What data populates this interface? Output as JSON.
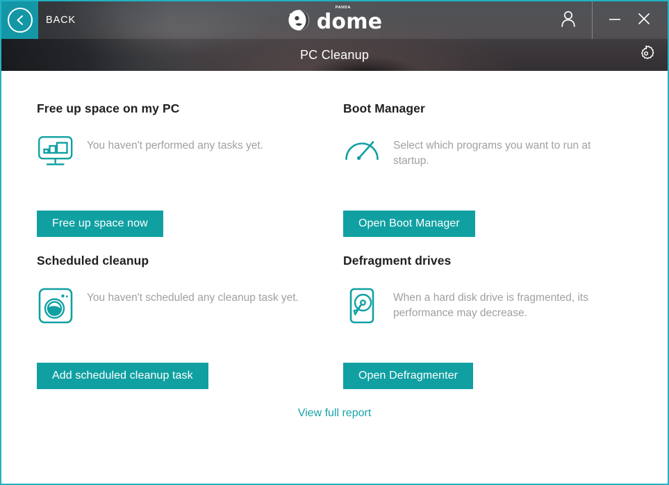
{
  "window": {
    "accent_color": "#11a0a2",
    "border_color": "#21b3c4",
    "back_label": "BACK",
    "brand_name": "dome",
    "brand_super": "PANDA",
    "page_title": "PC Cleanup",
    "icons": {
      "back": "chevron-left-icon",
      "account": "user-icon",
      "minimize": "minimize-icon",
      "close": "close-icon",
      "settings": "gear-icon"
    }
  },
  "cards": [
    {
      "title": "Free up space on my PC",
      "description": "You haven't performed any tasks yet.",
      "icon": "monitor-chart-icon",
      "button": "Free up space now"
    },
    {
      "title": "Boot Manager",
      "description": "Select which programs you want to run at startup.",
      "icon": "speedometer-icon",
      "button": "Open Boot Manager"
    },
    {
      "title": "Scheduled cleanup",
      "description": "You haven't scheduled any cleanup task yet.",
      "icon": "washing-machine-icon",
      "button": "Add scheduled cleanup task"
    },
    {
      "title": "Defragment drives",
      "description": "When a hard disk drive is fragmented, its performance may decrease.",
      "icon": "hard-disk-icon",
      "button": "Open Defragmenter"
    }
  ],
  "footer": {
    "report_link": "View full report"
  }
}
